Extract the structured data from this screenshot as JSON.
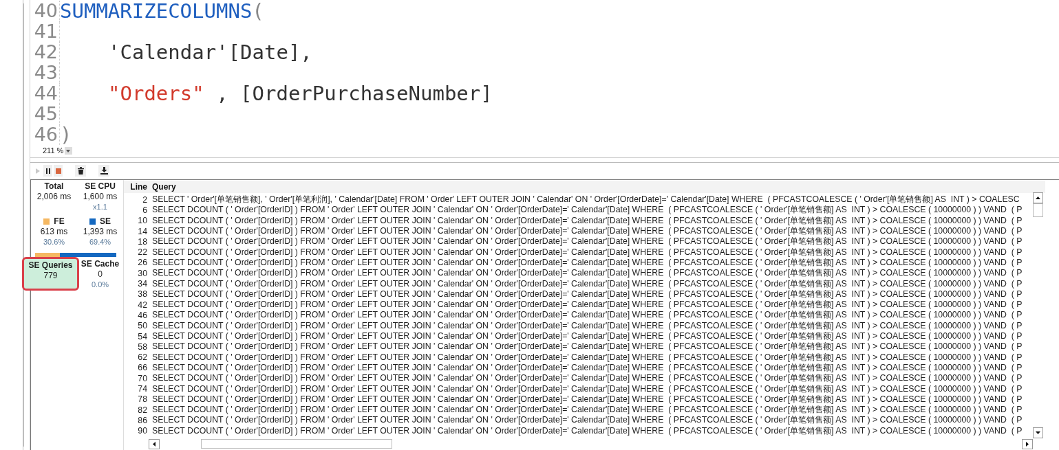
{
  "editor": {
    "lines": [
      {
        "number": "40",
        "tokens": [
          {
            "kind": "function",
            "text": "SUMMARIZECOLUMNS"
          },
          {
            "kind": "paren",
            "text": "("
          }
        ]
      },
      {
        "number": "41"
      },
      {
        "number": "42",
        "indented": true,
        "tokens": [
          {
            "kind": "plain",
            "text": "'Calendar'[Date],"
          }
        ]
      },
      {
        "number": "43"
      },
      {
        "number": "44",
        "indented": true,
        "tokens": [
          {
            "kind": "string",
            "text": "\"Orders\""
          },
          {
            "kind": "plain",
            "text": " , [OrderPurchaseNumber]"
          }
        ]
      },
      {
        "number": "45"
      },
      {
        "number": "46",
        "tokens": [
          {
            "kind": "paren",
            "text": ")"
          }
        ]
      }
    ],
    "zoom": "211 %"
  },
  "toolbar": [
    {
      "kind": "play",
      "disabled": true
    },
    {
      "kind": "pause",
      "disabled": false
    },
    {
      "kind": "stop",
      "disabled": false
    },
    {
      "kind": "clear",
      "disabled": false
    },
    {
      "kind": "export",
      "disabled": false
    }
  ],
  "stats": [
    {
      "label": "Total",
      "value": "2,006 ms",
      "selected": false,
      "callout": false
    },
    {
      "label": "SE CPU",
      "value": "1,600 ms",
      "note": "x1.1",
      "selected": false,
      "callout": false
    },
    {
      "label": "FE",
      "value": "613 ms",
      "note": "30.6%",
      "color": "#f5b862",
      "selected": false,
      "callout": false
    },
    {
      "label": "SE",
      "value": "1,393 ms",
      "note": "69.4%",
      "color": "#1468c0",
      "selected": false,
      "callout": false
    }
  ],
  "timing_bar": {
    "level": 0.306
  },
  "cache_stats": [
    {
      "label": "SE Queries",
      "value": "779",
      "selected": true,
      "callout": true
    },
    {
      "label": "SE Cache",
      "value": "0",
      "note": "0.0%",
      "selected": false,
      "callout": false
    }
  ],
  "table": {
    "columns": [
      "Line",
      "Query"
    ],
    "rows": [
      {
        "line": "2",
        "query": "SELECT ' Order'[单笔销售额], ' Order'[单笔利润], ' Calendar'[Date] FROM ' Order' LEFT OUTER JOIN ' Calendar' ON ' Order'[OrderDate]=' Calendar'[Date] WHERE  ( PFCASTCOALESCE ( ' Order'[单笔销售额] AS  INT ) > COALESC"
      },
      {
        "line": "6",
        "query": "SELECT DCOUNT ( ' Order'[OrderID] ) FROM ' Order' LEFT OUTER JOIN ' Calendar' ON ' Order'[OrderDate]=' Calendar'[Date] WHERE  ( PFCASTCOALESCE ( ' Order'[单笔销售额] AS  INT ) > COALESCE ( 10000000 ) ) VAND  ( P"
      },
      {
        "line": "10",
        "query": "SELECT DCOUNT ( ' Order'[OrderID] ) FROM ' Order' LEFT OUTER JOIN ' Calendar' ON ' Order'[OrderDate]=' Calendar'[Date] WHERE  ( PFCASTCOALESCE ( ' Order'[单笔销售额] AS  INT ) > COALESCE ( 10000000 ) ) VAND  ( P"
      },
      {
        "line": "14",
        "query": "SELECT DCOUNT ( ' Order'[OrderID] ) FROM ' Order' LEFT OUTER JOIN ' Calendar' ON ' Order'[OrderDate]=' Calendar'[Date] WHERE  ( PFCASTCOALESCE ( ' Order'[单笔销售额] AS  INT ) > COALESCE ( 10000000 ) ) VAND  ( P"
      },
      {
        "line": "18",
        "query": "SELECT DCOUNT ( ' Order'[OrderID] ) FROM ' Order' LEFT OUTER JOIN ' Calendar' ON ' Order'[OrderDate]=' Calendar'[Date] WHERE  ( PFCASTCOALESCE ( ' Order'[单笔销售额] AS  INT ) > COALESCE ( 10000000 ) ) VAND  ( P"
      },
      {
        "line": "22",
        "query": "SELECT DCOUNT ( ' Order'[OrderID] ) FROM ' Order' LEFT OUTER JOIN ' Calendar' ON ' Order'[OrderDate]=' Calendar'[Date] WHERE  ( PFCASTCOALESCE ( ' Order'[单笔销售额] AS  INT ) > COALESCE ( 10000000 ) ) VAND  ( P"
      },
      {
        "line": "26",
        "query": "SELECT DCOUNT ( ' Order'[OrderID] ) FROM ' Order' LEFT OUTER JOIN ' Calendar' ON ' Order'[OrderDate]=' Calendar'[Date] WHERE  ( PFCASTCOALESCE ( ' Order'[单笔销售额] AS  INT ) > COALESCE ( 10000000 ) ) VAND  ( P"
      },
      {
        "line": "30",
        "query": "SELECT DCOUNT ( ' Order'[OrderID] ) FROM ' Order' LEFT OUTER JOIN ' Calendar' ON ' Order'[OrderDate]=' Calendar'[Date] WHERE  ( PFCASTCOALESCE ( ' Order'[单笔销售额] AS  INT ) > COALESCE ( 10000000 ) ) VAND  ( P"
      },
      {
        "line": "34",
        "query": "SELECT DCOUNT ( ' Order'[OrderID] ) FROM ' Order' LEFT OUTER JOIN ' Calendar' ON ' Order'[OrderDate]=' Calendar'[Date] WHERE  ( PFCASTCOALESCE ( ' Order'[单笔销售额] AS  INT ) > COALESCE ( 10000000 ) ) VAND  ( P"
      },
      {
        "line": "38",
        "query": "SELECT DCOUNT ( ' Order'[OrderID] ) FROM ' Order' LEFT OUTER JOIN ' Calendar' ON ' Order'[OrderDate]=' Calendar'[Date] WHERE  ( PFCASTCOALESCE ( ' Order'[单笔销售额] AS  INT ) > COALESCE ( 10000000 ) ) VAND  ( P"
      },
      {
        "line": "42",
        "query": "SELECT DCOUNT ( ' Order'[OrderID] ) FROM ' Order' LEFT OUTER JOIN ' Calendar' ON ' Order'[OrderDate]=' Calendar'[Date] WHERE  ( PFCASTCOALESCE ( ' Order'[单笔销售额] AS  INT ) > COALESCE ( 10000000 ) ) VAND  ( P"
      },
      {
        "line": "46",
        "query": "SELECT DCOUNT ( ' Order'[OrderID] ) FROM ' Order' LEFT OUTER JOIN ' Calendar' ON ' Order'[OrderDate]=' Calendar'[Date] WHERE  ( PFCASTCOALESCE ( ' Order'[单笔销售额] AS  INT ) > COALESCE ( 10000000 ) ) VAND  ( P"
      },
      {
        "line": "50",
        "query": "SELECT DCOUNT ( ' Order'[OrderID] ) FROM ' Order' LEFT OUTER JOIN ' Calendar' ON ' Order'[OrderDate]=' Calendar'[Date] WHERE  ( PFCASTCOALESCE ( ' Order'[单笔销售额] AS  INT ) > COALESCE ( 10000000 ) ) VAND  ( P"
      },
      {
        "line": "54",
        "query": "SELECT DCOUNT ( ' Order'[OrderID] ) FROM ' Order' LEFT OUTER JOIN ' Calendar' ON ' Order'[OrderDate]=' Calendar'[Date] WHERE  ( PFCASTCOALESCE ( ' Order'[单笔销售额] AS  INT ) > COALESCE ( 10000000 ) ) VAND  ( P"
      },
      {
        "line": "58",
        "query": "SELECT DCOUNT ( ' Order'[OrderID] ) FROM ' Order' LEFT OUTER JOIN ' Calendar' ON ' Order'[OrderDate]=' Calendar'[Date] WHERE  ( PFCASTCOALESCE ( ' Order'[单笔销售额] AS  INT ) > COALESCE ( 10000000 ) ) VAND  ( P"
      },
      {
        "line": "62",
        "query": "SELECT DCOUNT ( ' Order'[OrderID] ) FROM ' Order' LEFT OUTER JOIN ' Calendar' ON ' Order'[OrderDate]=' Calendar'[Date] WHERE  ( PFCASTCOALESCE ( ' Order'[单笔销售额] AS  INT ) > COALESCE ( 10000000 ) ) VAND  ( P"
      },
      {
        "line": "66",
        "query": "SELECT DCOUNT ( ' Order'[OrderID] ) FROM ' Order' LEFT OUTER JOIN ' Calendar' ON ' Order'[OrderDate]=' Calendar'[Date] WHERE  ( PFCASTCOALESCE ( ' Order'[单笔销售额] AS  INT ) > COALESCE ( 10000000 ) ) VAND  ( P"
      },
      {
        "line": "70",
        "query": "SELECT DCOUNT ( ' Order'[OrderID] ) FROM ' Order' LEFT OUTER JOIN ' Calendar' ON ' Order'[OrderDate]=' Calendar'[Date] WHERE  ( PFCASTCOALESCE ( ' Order'[单笔销售额] AS  INT ) > COALESCE ( 10000000 ) ) VAND  ( P"
      },
      {
        "line": "74",
        "query": "SELECT DCOUNT ( ' Order'[OrderID] ) FROM ' Order' LEFT OUTER JOIN ' Calendar' ON ' Order'[OrderDate]=' Calendar'[Date] WHERE  ( PFCASTCOALESCE ( ' Order'[单笔销售额] AS  INT ) > COALESCE ( 10000000 ) ) VAND  ( P"
      },
      {
        "line": "78",
        "query": "SELECT DCOUNT ( ' Order'[OrderID] ) FROM ' Order' LEFT OUTER JOIN ' Calendar' ON ' Order'[OrderDate]=' Calendar'[Date] WHERE  ( PFCASTCOALESCE ( ' Order'[单笔销售额] AS  INT ) > COALESCE ( 10000000 ) ) VAND  ( P"
      },
      {
        "line": "82",
        "query": "SELECT DCOUNT ( ' Order'[OrderID] ) FROM ' Order' LEFT OUTER JOIN ' Calendar' ON ' Order'[OrderDate]=' Calendar'[Date] WHERE  ( PFCASTCOALESCE ( ' Order'[单笔销售额] AS  INT ) > COALESCE ( 10000000 ) ) VAND  ( P"
      },
      {
        "line": "86",
        "query": "SELECT DCOUNT ( ' Order'[OrderID] ) FROM ' Order' LEFT OUTER JOIN ' Calendar' ON ' Order'[OrderDate]=' Calendar'[Date] WHERE  ( PFCASTCOALESCE ( ' Order'[单笔销售额] AS  INT ) > COALESCE ( 10000000 ) ) VAND  ( P"
      },
      {
        "line": "90",
        "query": "SELECT DCOUNT ( ' Order'[OrderID] ) FROM ' Order' LEFT OUTER JOIN ' Calendar' ON ' Order'[OrderDate]=' Calendar'[Date] WHERE  ( PFCASTCOALESCE ( ' Order'[单笔销售额] AS  INT ) > COALESCE ( 10000000 ) ) VAND  ( P"
      }
    ]
  }
}
